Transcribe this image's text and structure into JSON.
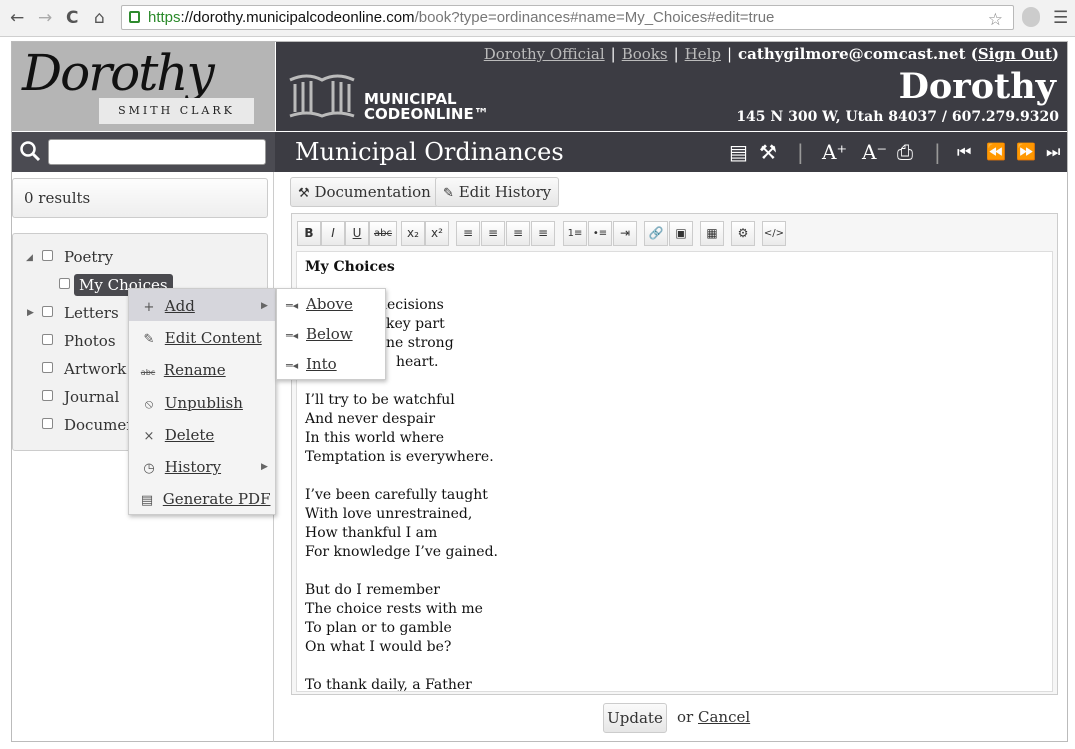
{
  "browser": {
    "url_scheme": "https",
    "url_host": "://dorothy.municipalcodeonline.com",
    "url_path": "/book?type=ordinances#name=My_Choices#edit=true",
    "nav": [
      "←",
      "→",
      "C",
      "⌂"
    ]
  },
  "header": {
    "logo_script": "Dorothy",
    "logo_sub": "SMITH CLARK",
    "brand_line1": "MUNICIPAL",
    "brand_line2": "CODEONLINE™",
    "links": [
      "Dorothy Official",
      "Books",
      "Help"
    ],
    "user_email": "cathygilmore@comcast.net",
    "sign_out": "Sign Out",
    "city": "Dorothy",
    "address": "145 N 300 W, Utah 84037 / 607.279.9320"
  },
  "toolbar": {
    "page_title": "Municipal Ordinances",
    "font_increase": "A⁺",
    "font_decrease": "A⁻"
  },
  "sidebar": {
    "results": "0 results",
    "tree": [
      "Poetry",
      "My Choices",
      "Letters",
      "Photos",
      "Artwork",
      "Journal",
      "Documen"
    ]
  },
  "context_menu": {
    "items": [
      "Add",
      "Edit Content",
      "Rename",
      "Unpublish",
      "Delete",
      "History",
      "Generate PDF"
    ],
    "submenu": [
      "Above",
      "Below",
      "Into"
    ]
  },
  "tabs": {
    "documentation": "Documentation",
    "edit_history": "Edit History"
  },
  "editor": {
    "buttons": [
      "B",
      "I",
      "U",
      "abc",
      "x₂",
      "x²",
      "≡",
      "≡",
      "≡",
      "≡",
      "1≡",
      "•≡",
      "⇥",
      "🔗",
      "▣",
      "▦",
      "⚙",
      "</>"
    ],
    "title": "My Choices",
    "stanza1": [
      "decisions",
      "key part",
      "ne strong",
      "heart."
    ],
    "stanza2": [
      "I’ll try to be watchful",
      "And never despair",
      "In this world where",
      "Temptation is everywhere."
    ],
    "stanza3": [
      "I’ve been carefully taught",
      "With love unrestrained,",
      "How thankful I am",
      "For knowledge I’ve gained."
    ],
    "stanza4": [
      "But do I remember",
      "The choice rests with me",
      "To plan or to gamble",
      "On what I would be?"
    ],
    "stanza5": [
      "To thank daily, a Father"
    ]
  },
  "footer": {
    "update": "Update",
    "or": "or",
    "cancel": "Cancel"
  },
  "colors": {
    "header_bg": "#3c3c43",
    "logo_bg": "#b5b5b5",
    "selected": "#4a4a4f",
    "url_green": "#2a8a2a"
  }
}
